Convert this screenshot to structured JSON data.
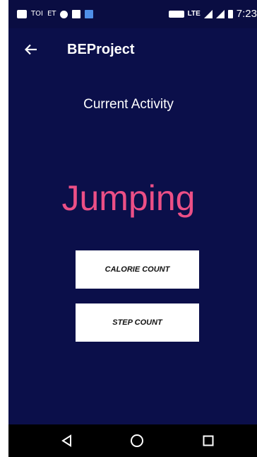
{
  "status_bar": {
    "left_text_1": "TOI",
    "left_text_2": "ET",
    "network": "LTE",
    "time": "7:23"
  },
  "app_bar": {
    "title": "BEProject",
    "back_icon": "arrow-left-icon"
  },
  "main": {
    "label": "Current Activity",
    "activity": "Jumping",
    "activity_color": "#ec4f86",
    "buttons": {
      "calorie": "CALORIE COUNT",
      "step": "STEP COUNT"
    }
  },
  "nav_bar": {
    "icons": [
      "triangle-back-icon",
      "circle-home-icon",
      "square-recents-icon"
    ]
  },
  "colors": {
    "background": "#0b0f4a",
    "accent": "#ec4f86"
  }
}
